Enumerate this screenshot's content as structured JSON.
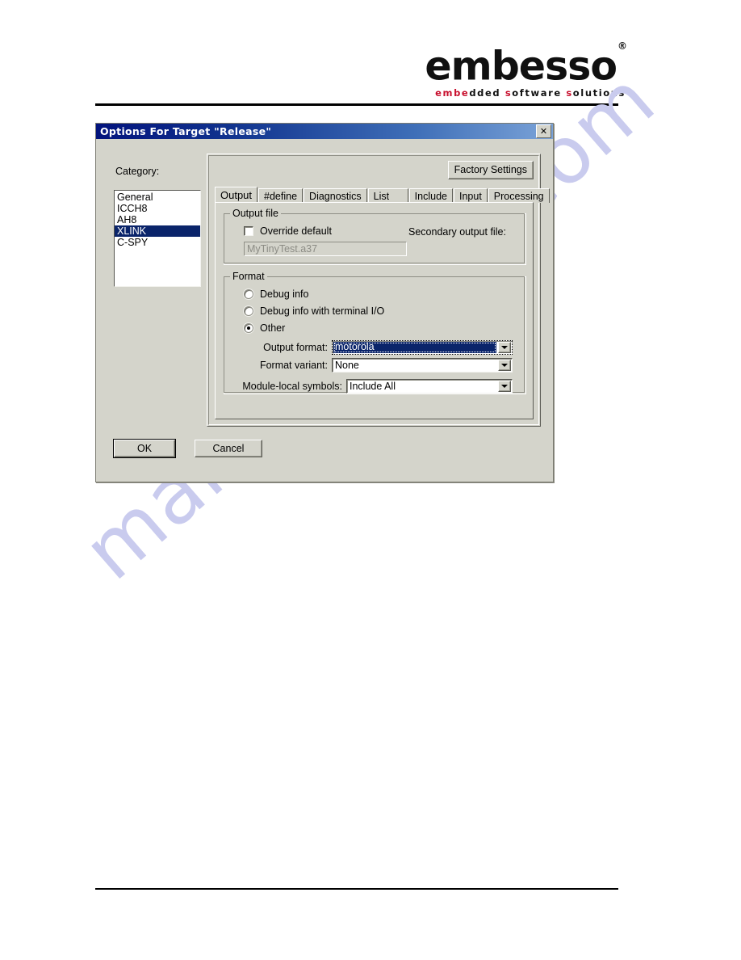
{
  "brand": {
    "name": "embesso",
    "registered": "®",
    "tagline_parts": {
      "a": "em",
      "b": "be",
      "c": "dded ",
      "d": "s",
      "e": "oftware ",
      "f": "s",
      "g": "olutions"
    },
    "tagline_full": "embedded software solutions"
  },
  "watermark": {
    "text": "manualshive.com",
    "color": "#c9cbee"
  },
  "dialog": {
    "title": "Options For Target \"Release\"",
    "close_label": "✕",
    "accent_title_start": "#02137d",
    "accent_title_end": "#7ba3d8",
    "selection_color": "#0a246a",
    "face_color": "#d4d4cb",
    "category": {
      "label": "Category:",
      "items": [
        {
          "label": "General",
          "selected": false
        },
        {
          "label": "ICCH8",
          "selected": false
        },
        {
          "label": "AH8",
          "selected": false
        },
        {
          "label": "XLINK",
          "selected": true
        },
        {
          "label": "C-SPY",
          "selected": false
        }
      ]
    },
    "factory_settings_label": "Factory Settings",
    "tabs": [
      {
        "label": "Output",
        "active": true
      },
      {
        "label": "#define",
        "active": false
      },
      {
        "label": "Diagnostics",
        "active": false
      },
      {
        "label": "List",
        "active": false
      },
      {
        "label": "Include",
        "active": false
      },
      {
        "label": "Input",
        "active": false
      },
      {
        "label": "Processing",
        "active": false
      }
    ],
    "output_file_group": {
      "title": "Output file",
      "override_default_label": "Override default",
      "override_default_checked": false,
      "filename_value": "MyTinyTest.a37",
      "filename_disabled": true,
      "secondary_output_label": "Secondary output file:"
    },
    "format_group": {
      "title": "Format",
      "radios": [
        {
          "label": "Debug info",
          "selected": false
        },
        {
          "label": "Debug info with terminal I/O",
          "selected": false
        },
        {
          "label": "Other",
          "selected": true
        }
      ],
      "output_format": {
        "label": "Output format:",
        "value": "motorola",
        "focused": true
      },
      "format_variant": {
        "label": "Format variant:",
        "value": "None",
        "focused": false
      },
      "module_local_symbols": {
        "label": "Module-local symbols:",
        "value": "Include All",
        "focused": false
      }
    },
    "buttons": {
      "ok": "OK",
      "cancel": "Cancel"
    }
  }
}
